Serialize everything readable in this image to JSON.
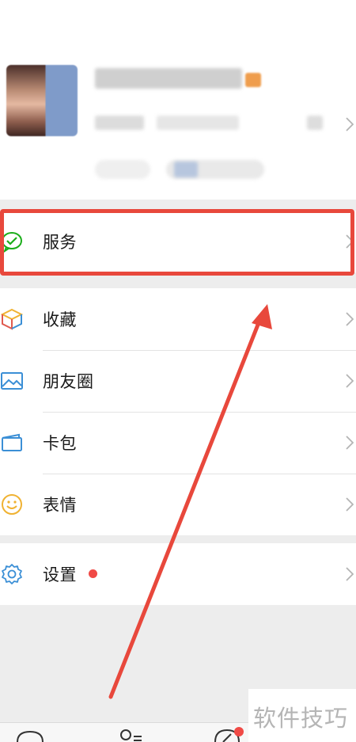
{
  "menu": {
    "service": "服务",
    "favorites": "收藏",
    "moments": "朋友圈",
    "cards": "卡包",
    "stickers": "表情",
    "settings": "设置"
  },
  "watermark": "软件技巧",
  "colors": {
    "highlight": "#e8483c",
    "badge": "#f04a46",
    "icon_green": "#1aad19",
    "icon_blue": "#3b8fd6",
    "icon_yellow": "#f0b232"
  },
  "icons": {
    "service": "wechat-pay-icon",
    "favorites": "cube-icon",
    "moments": "picture-icon",
    "cards": "wallet-icon",
    "stickers": "smiley-icon",
    "settings": "gear-icon"
  }
}
